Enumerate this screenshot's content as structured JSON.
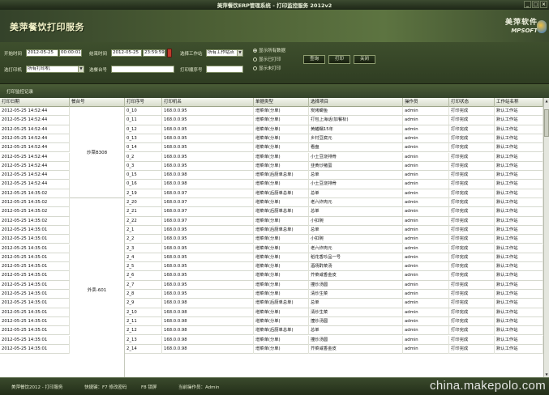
{
  "window": {
    "title": "美萍餐饮ERP管理系统 - 打印监控服务 2012v2",
    "min": "_",
    "max": "□",
    "close": "×"
  },
  "header": {
    "app_name": "美萍餐饮打印服务",
    "logo_cn": "美萍软件",
    "logo_en": "MPSOFT"
  },
  "filters": {
    "start_label": "开始时间",
    "start_date": "2012-05-25",
    "start_time": "00:00:01",
    "end_label": "结束时间",
    "end_date": "2012-05-25",
    "end_time": "23:59:59",
    "station_label": "选择工作站",
    "station_value": "所有工作站点",
    "printer_label": "选打印机",
    "printer_value": "所有打印机",
    "seat_label": "选餐台号",
    "seat_value": "",
    "print_no_label": "打印顺序号",
    "print_no_value": "",
    "radios": [
      {
        "label": "显示所有数据",
        "checked": true
      },
      {
        "label": "显示已打印",
        "checked": false
      },
      {
        "label": "显示未打印",
        "checked": false
      }
    ],
    "buttons": {
      "query": "查询",
      "print": "打印",
      "close": "关闭"
    }
  },
  "section_label": "打印监控记录",
  "table": {
    "columns": [
      "打印日期",
      "餐台号",
      "打印序号",
      "打印机名",
      "单据类型",
      "选择项目",
      "操作员",
      "打印状态",
      "工作站名称"
    ],
    "groups": [
      {
        "label": "炒菜B308",
        "start": 0,
        "count": 10
      },
      {
        "label": "外卖-601",
        "start": 10,
        "count": 20
      }
    ],
    "rows": [
      [
        "2012-05-25 14:52:44",
        "",
        "0_10",
        "168.0.0.95",
        "增菜单(分单)",
        "炭烤鲫鱼",
        "admin",
        "打印完成",
        "默认工作站"
      ],
      [
        "2012-05-25 14:52:44",
        "",
        "0_11",
        "168.0.0.95",
        "增菜单(分单)",
        "打包上海话(加餐标)",
        "admin",
        "打印完成",
        "默认工作站"
      ],
      [
        "2012-05-25 14:52:44",
        "",
        "0_12",
        "168.0.0.95",
        "增菜单(分单)",
        "黄鳝糯15年",
        "admin",
        "打印完成",
        "默认工作站"
      ],
      [
        "2012-05-25 14:52:44",
        "",
        "0_13",
        "168.0.0.95",
        "增菜单(分单)",
        "乡村豆腐元",
        "admin",
        "打印完成",
        "默认工作站"
      ],
      [
        "2012-05-25 14:52:44",
        "",
        "0_14",
        "168.0.0.95",
        "增菜单(分单)",
        "看盘",
        "admin",
        "打印完成",
        "默认工作站"
      ],
      [
        "2012-05-25 14:52:44",
        "",
        "0_2",
        "168.0.0.95",
        "增菜单(分单)",
        "小土豆烧排骨",
        "admin",
        "打印完成",
        "默认工作站"
      ],
      [
        "2012-05-25 14:52:44",
        "",
        "0_3",
        "168.0.0.95",
        "增菜单(分单)",
        "韭黄炒猪蛋",
        "admin",
        "打印完成",
        "默认工作站"
      ],
      [
        "2012-05-25 14:52:44",
        "",
        "0_15",
        "168.0.0.98",
        "增菜单(后厨单总单)",
        "总单",
        "admin",
        "打印完成",
        "默认工作站"
      ],
      [
        "2012-05-25 14:52:44",
        "",
        "0_16",
        "168.0.0.98",
        "增菜单(分单)",
        "小土豆烧排骨",
        "admin",
        "打印完成",
        "默认工作站"
      ],
      [
        "2012-05-25 14:35:02",
        "",
        "2_19",
        "168.0.0.97",
        "增菜单(后厨单总单)",
        "总单",
        "admin",
        "打印完成",
        "默认工作站"
      ],
      [
        "2012-05-25 14:35:02",
        "",
        "2_20",
        "168.0.0.97",
        "增菜单(分单)",
        "老六炸肉元",
        "admin",
        "打印完成",
        "默认工作站"
      ],
      [
        "2012-05-25 14:35:02",
        "",
        "2_21",
        "168.0.0.97",
        "增菜单(后厨单总单)",
        "总单",
        "admin",
        "打印完成",
        "默认工作站"
      ],
      [
        "2012-05-25 14:35:02",
        "",
        "2_22",
        "168.0.0.97",
        "增菜单(分单)",
        "小扣碗",
        "admin",
        "打印完成",
        "默认工作站"
      ],
      [
        "2012-05-25 14:35:01",
        "",
        "2_1",
        "168.0.0.95",
        "增菜单(后厨单总单)",
        "总单",
        "admin",
        "打印完成",
        "默认工作站"
      ],
      [
        "2012-05-25 14:35:01",
        "",
        "2_2",
        "168.0.0.95",
        "增菜单(分单)",
        "小扣碗",
        "admin",
        "打印完成",
        "默认工作站"
      ],
      [
        "2012-05-25 14:35:01",
        "",
        "2_3",
        "168.0.0.95",
        "增菜单(分单)",
        "老六炸肉元",
        "admin",
        "打印完成",
        "默认工作站"
      ],
      [
        "2012-05-25 14:35:01",
        "",
        "2_4",
        "168.0.0.95",
        "增菜单(分单)",
        "稻花香珍品一号",
        "admin",
        "打印完成",
        "默认工作站"
      ],
      [
        "2012-05-25 14:35:01",
        "",
        "2_5",
        "168.0.0.95",
        "增菜单(分单)",
        "酒场酢菜汤",
        "admin",
        "打印完成",
        "默认工作站"
      ],
      [
        "2012-05-25 14:35:01",
        "",
        "2_6",
        "168.0.0.95",
        "增菜单(分单)",
        "芥菜咸香金皮",
        "admin",
        "打印完成",
        "默认工作站"
      ],
      [
        "2012-05-25 14:35:01",
        "",
        "2_7",
        "168.0.0.95",
        "增菜单(分单)",
        "撞炒汤圆",
        "admin",
        "打印完成",
        "默认工作站"
      ],
      [
        "2012-05-25 14:35:01",
        "",
        "2_8",
        "168.0.0.95",
        "增菜单(分单)",
        "清炒生菜",
        "admin",
        "打印完成",
        "默认工作站"
      ],
      [
        "2012-05-25 14:35:01",
        "",
        "2_9",
        "168.0.0.98",
        "增菜单(后厨单总单)",
        "总单",
        "admin",
        "打印完成",
        "默认工作站"
      ],
      [
        "2012-05-25 14:35:01",
        "",
        "2_10",
        "168.0.0.98",
        "增菜单(分单)",
        "清炒生菜",
        "admin",
        "打印完成",
        "默认工作站"
      ],
      [
        "2012-05-25 14:35:01",
        "",
        "2_11",
        "168.0.0.98",
        "增菜单(分单)",
        "撞炒汤圆",
        "admin",
        "打印完成",
        "默认工作站"
      ],
      [
        "2012-05-25 14:35:01",
        "",
        "2_12",
        "168.0.0.98",
        "增菜单(后厨单总单)",
        "总单",
        "admin",
        "打印完成",
        "默认工作站"
      ],
      [
        "2012-05-25 14:35:01",
        "",
        "2_13",
        "168.0.0.98",
        "增菜单(分单)",
        "撞炒汤圆",
        "admin",
        "打印完成",
        "默认工作站"
      ],
      [
        "2012-05-25 14:35:01",
        "",
        "2_14",
        "168.0.0.98",
        "增菜单(分单)",
        "芥菜咸香金皮",
        "admin",
        "打印完成",
        "默认工作站"
      ]
    ]
  },
  "statusbar": {
    "app": "美萍餐饮2012 - 打印服务",
    "shortcut": "快捷键：F7 修改密码",
    "f8": "F8 锁屏",
    "operator": "当前操作员：Admin"
  },
  "watermark": "china.makepolo.com"
}
